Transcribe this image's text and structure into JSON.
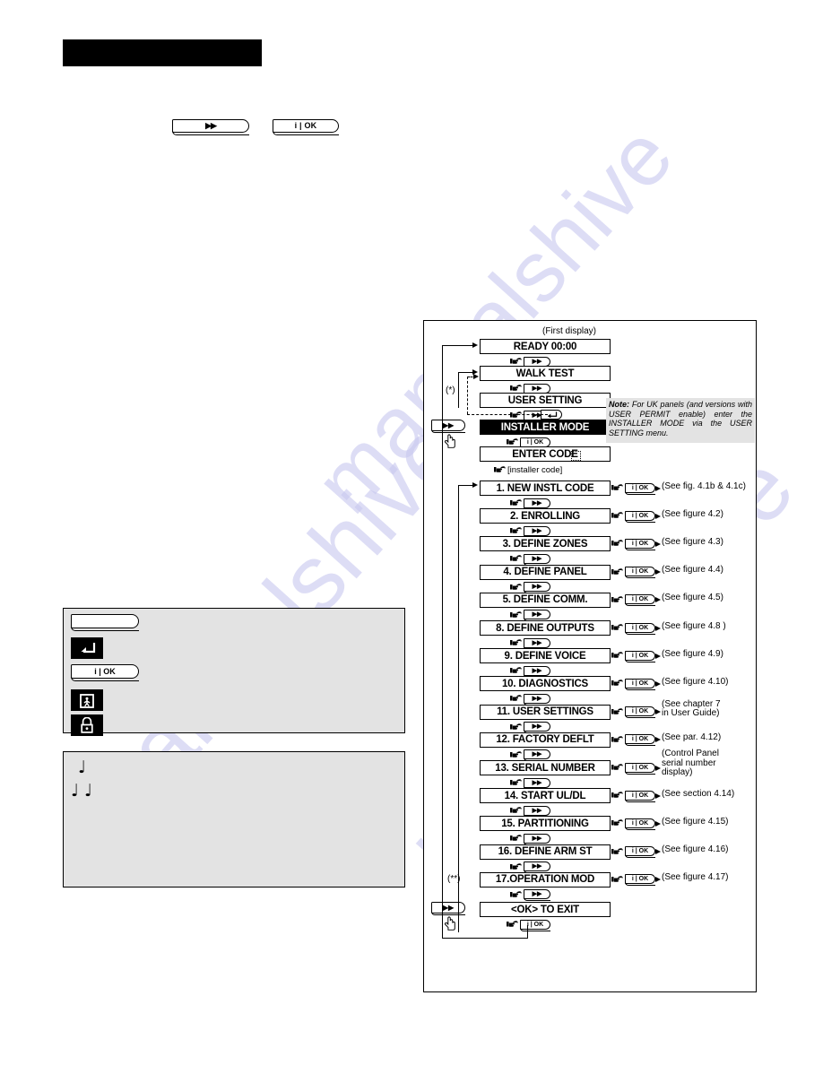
{
  "page": {
    "watermark": "manualshive",
    "redacted_title_bar": true
  },
  "top_keys": [
    {
      "name": "fast-forward-key",
      "label": "▶▶"
    },
    {
      "name": "info-ok-key",
      "label": "i | OK"
    }
  ],
  "legend_keys": {
    "items": [
      {
        "icon": "fast-forward-key-icon",
        "label": ""
      },
      {
        "icon": "back-arrow-icon",
        "label": ""
      },
      {
        "icon": "info-ok-key-icon",
        "label": "i | OK"
      },
      {
        "icon": "away-arm-icon",
        "label": ""
      },
      {
        "icon": "home-arm-lock-icon",
        "label": ""
      }
    ]
  },
  "legend_tones": {
    "items": [
      {
        "icon": "single-note-icon",
        "label": ""
      },
      {
        "icon": "double-note-icon",
        "label": ""
      }
    ]
  },
  "flowchart": {
    "first_display_caption": "(First display)",
    "star_marker": "(*)",
    "double_star_marker": "(**)",
    "note": {
      "label": "Note:",
      "text": "For UK panels (and versions with USER PERMIT enable) enter the INSTALLER MODE via the USER SETTING menu."
    },
    "keys": {
      "next": "▶▶",
      "ok": "i | OK",
      "back": "↰"
    },
    "installer_code_prompt": "[installer code]",
    "head_rows": [
      {
        "display": "READY 00:00",
        "key": "▶▶",
        "inverted": false
      },
      {
        "display": "WALK TEST",
        "key": "▶▶",
        "inverted": false
      },
      {
        "display": "USER SETTING",
        "key": "▶▶",
        "inverted": false
      },
      {
        "display": "INSTALLER MODE",
        "key": "i | OK",
        "inverted": true
      },
      {
        "display": "ENTER CODE",
        "key": "",
        "inverted": false
      }
    ],
    "menu_rows": [
      {
        "display": "1. NEW INSTL CODE",
        "key": "i | OK",
        "ref": "(See fig. 4.1b & 4.1c)"
      },
      {
        "display": "2. ENROLLING",
        "key": "i | OK",
        "ref": "(See figure 4.2)"
      },
      {
        "display": "3. DEFINE ZONES",
        "key": "i | OK",
        "ref": "(See figure 4.3)"
      },
      {
        "display": "4. DEFINE PANEL",
        "key": "i | OK",
        "ref": "(See figure 4.4)"
      },
      {
        "display": "5. DEFINE COMM.",
        "key": "i | OK",
        "ref": "(See figure 4.5)"
      },
      {
        "display": "8. DEFINE OUTPUTS",
        "key": "i | OK",
        "ref": "(See figure 4.8 )"
      },
      {
        "display": "9. DEFINE VOICE",
        "key": "i | OK",
        "ref": "(See figure 4.9)"
      },
      {
        "display": "10. DIAGNOSTICS",
        "key": "i | OK",
        "ref": "(See figure 4.10)"
      },
      {
        "display": "11. USER SETTINGS",
        "key": "i | OK",
        "ref": "(See chapter 7\nin User Guide)"
      },
      {
        "display": "12. FACTORY DEFLT",
        "key": "i | OK",
        "ref": "(See par. 4.12)"
      },
      {
        "display": "13. SERIAL NUMBER",
        "key": "i | OK",
        "ref": "(Control Panel\nserial number\ndisplay)"
      },
      {
        "display": "14. START UL/DL",
        "key": "i | OK",
        "ref": "(See section 4.14)"
      },
      {
        "display": "15. PARTITIONING",
        "key": "i | OK",
        "ref": "(See figure 4.15)"
      },
      {
        "display": "16. DEFINE ARM ST",
        "key": "i | OK",
        "ref": "(See figure 4.16)"
      },
      {
        "display": "17.OPERATION MOD",
        "key": "i | OK",
        "ref": "(See figure 4.17)"
      }
    ],
    "exit_row": {
      "display": "<OK> TO EXIT",
      "key": "i | OK",
      "side_key": "▶▶"
    }
  },
  "colors": {
    "ink": "#000000",
    "panel_gray": "#e3e3e3",
    "watermark": "#c9c9ef"
  }
}
